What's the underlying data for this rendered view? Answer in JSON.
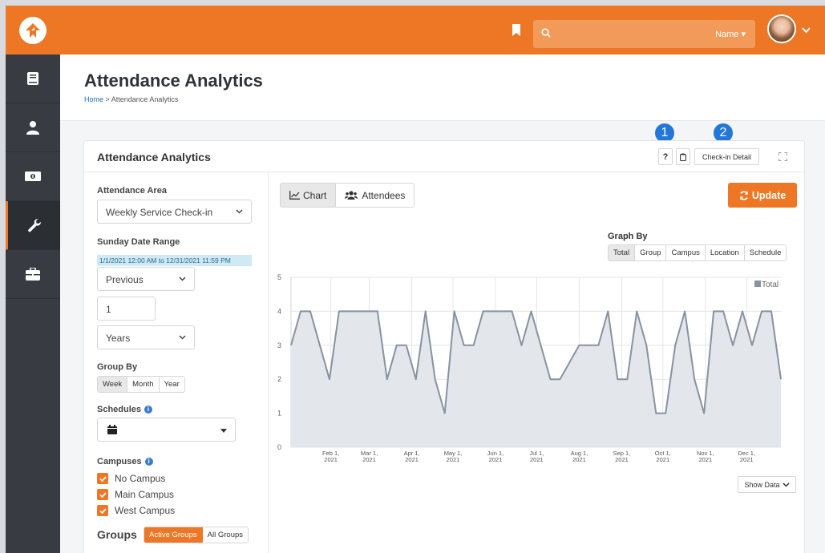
{
  "header": {
    "search_placeholder": "",
    "search_scope": "Name ▾"
  },
  "page": {
    "title": "Attendance Analytics",
    "breadcrumb_home": "Home",
    "breadcrumb_sep": " > ",
    "breadcrumb_current": "Attendance Analytics"
  },
  "callouts": [
    "1",
    "2"
  ],
  "panel": {
    "title": "Attendance Analytics",
    "help_label": "?",
    "checkin_detail_label": "Check-in Detail"
  },
  "filters": {
    "attendance_area_label": "Attendance Area",
    "attendance_area_value": "Weekly Service Check-in",
    "date_range_label": "Sunday Date Range",
    "date_range_display": "1/1/2021 12:00 AM to 12/31/2021 11:59 PM",
    "range_type": "Previous",
    "range_number": "1",
    "range_unit": "Years",
    "group_by_label": "Group By",
    "group_by_options": [
      "Week",
      "Month",
      "Year"
    ],
    "group_by_selected": "Week",
    "schedules_label": "Schedules",
    "campuses_label": "Campuses",
    "campuses": [
      "No Campus",
      "Main Campus",
      "West Campus"
    ],
    "groups_label": "Groups",
    "groups_options": [
      "Active Groups",
      "All Groups"
    ],
    "groups_selected": "Active Groups"
  },
  "view_tabs": [
    "Chart",
    "Attendees"
  ],
  "view_selected": "Chart",
  "update_label": "Update",
  "graph_by": {
    "label": "Graph By",
    "options": [
      "Total",
      "Group",
      "Campus",
      "Location",
      "Schedule"
    ],
    "selected": "Total"
  },
  "show_data_label": "Show Data",
  "colors": {
    "accent": "#ee7725",
    "sidebar": "#383c42",
    "series_line": "#8793a1",
    "series_fill": "#e3e6ea"
  },
  "chart_data": {
    "type": "area",
    "title": "",
    "xlabel": "",
    "ylabel": "",
    "ylim": [
      0,
      5
    ],
    "yticks": [
      0,
      1,
      2,
      3,
      4,
      5
    ],
    "xticks": [
      "Feb 1, 2021",
      "Mar 1, 2021",
      "Apr 1, 2021",
      "May 1, 2021",
      "Jun 1, 2021",
      "Jul 1, 2021",
      "Aug 1, 2021",
      "Sep 1, 2021",
      "Oct 1, 2021",
      "Nov 1, 2021",
      "Dec 1, 2021"
    ],
    "grid": true,
    "legend": "top-right",
    "series": [
      {
        "name": "Total",
        "x": [
          "2021-01-03",
          "2021-01-10",
          "2021-01-17",
          "2021-01-24",
          "2021-01-31",
          "2021-02-07",
          "2021-02-14",
          "2021-02-21",
          "2021-02-28",
          "2021-03-07",
          "2021-03-14",
          "2021-03-21",
          "2021-03-28",
          "2021-04-04",
          "2021-04-11",
          "2021-04-18",
          "2021-04-25",
          "2021-05-02",
          "2021-05-09",
          "2021-05-16",
          "2021-05-23",
          "2021-05-30",
          "2021-06-06",
          "2021-06-13",
          "2021-06-20",
          "2021-06-27",
          "2021-07-04",
          "2021-07-11",
          "2021-07-18",
          "2021-07-25",
          "2021-08-01",
          "2021-08-08",
          "2021-08-15",
          "2021-08-22",
          "2021-08-29",
          "2021-09-05",
          "2021-09-12",
          "2021-09-19",
          "2021-09-26",
          "2021-10-03",
          "2021-10-10",
          "2021-10-17",
          "2021-10-24",
          "2021-10-31",
          "2021-11-07",
          "2021-11-14",
          "2021-11-21",
          "2021-11-28",
          "2021-12-05",
          "2021-12-12",
          "2021-12-19",
          "2021-12-26"
        ],
        "values": [
          3,
          4,
          4,
          3,
          2,
          4,
          4,
          4,
          4,
          4,
          2,
          3,
          3,
          2,
          4,
          2,
          1,
          4,
          3,
          3,
          4,
          4,
          4,
          4,
          3,
          4,
          3,
          2,
          2,
          2.5,
          3,
          3,
          3,
          4,
          2,
          2,
          4,
          3,
          1,
          1,
          3,
          4,
          2,
          1,
          4,
          4,
          3,
          4,
          3,
          4,
          4,
          2
        ]
      }
    ]
  }
}
